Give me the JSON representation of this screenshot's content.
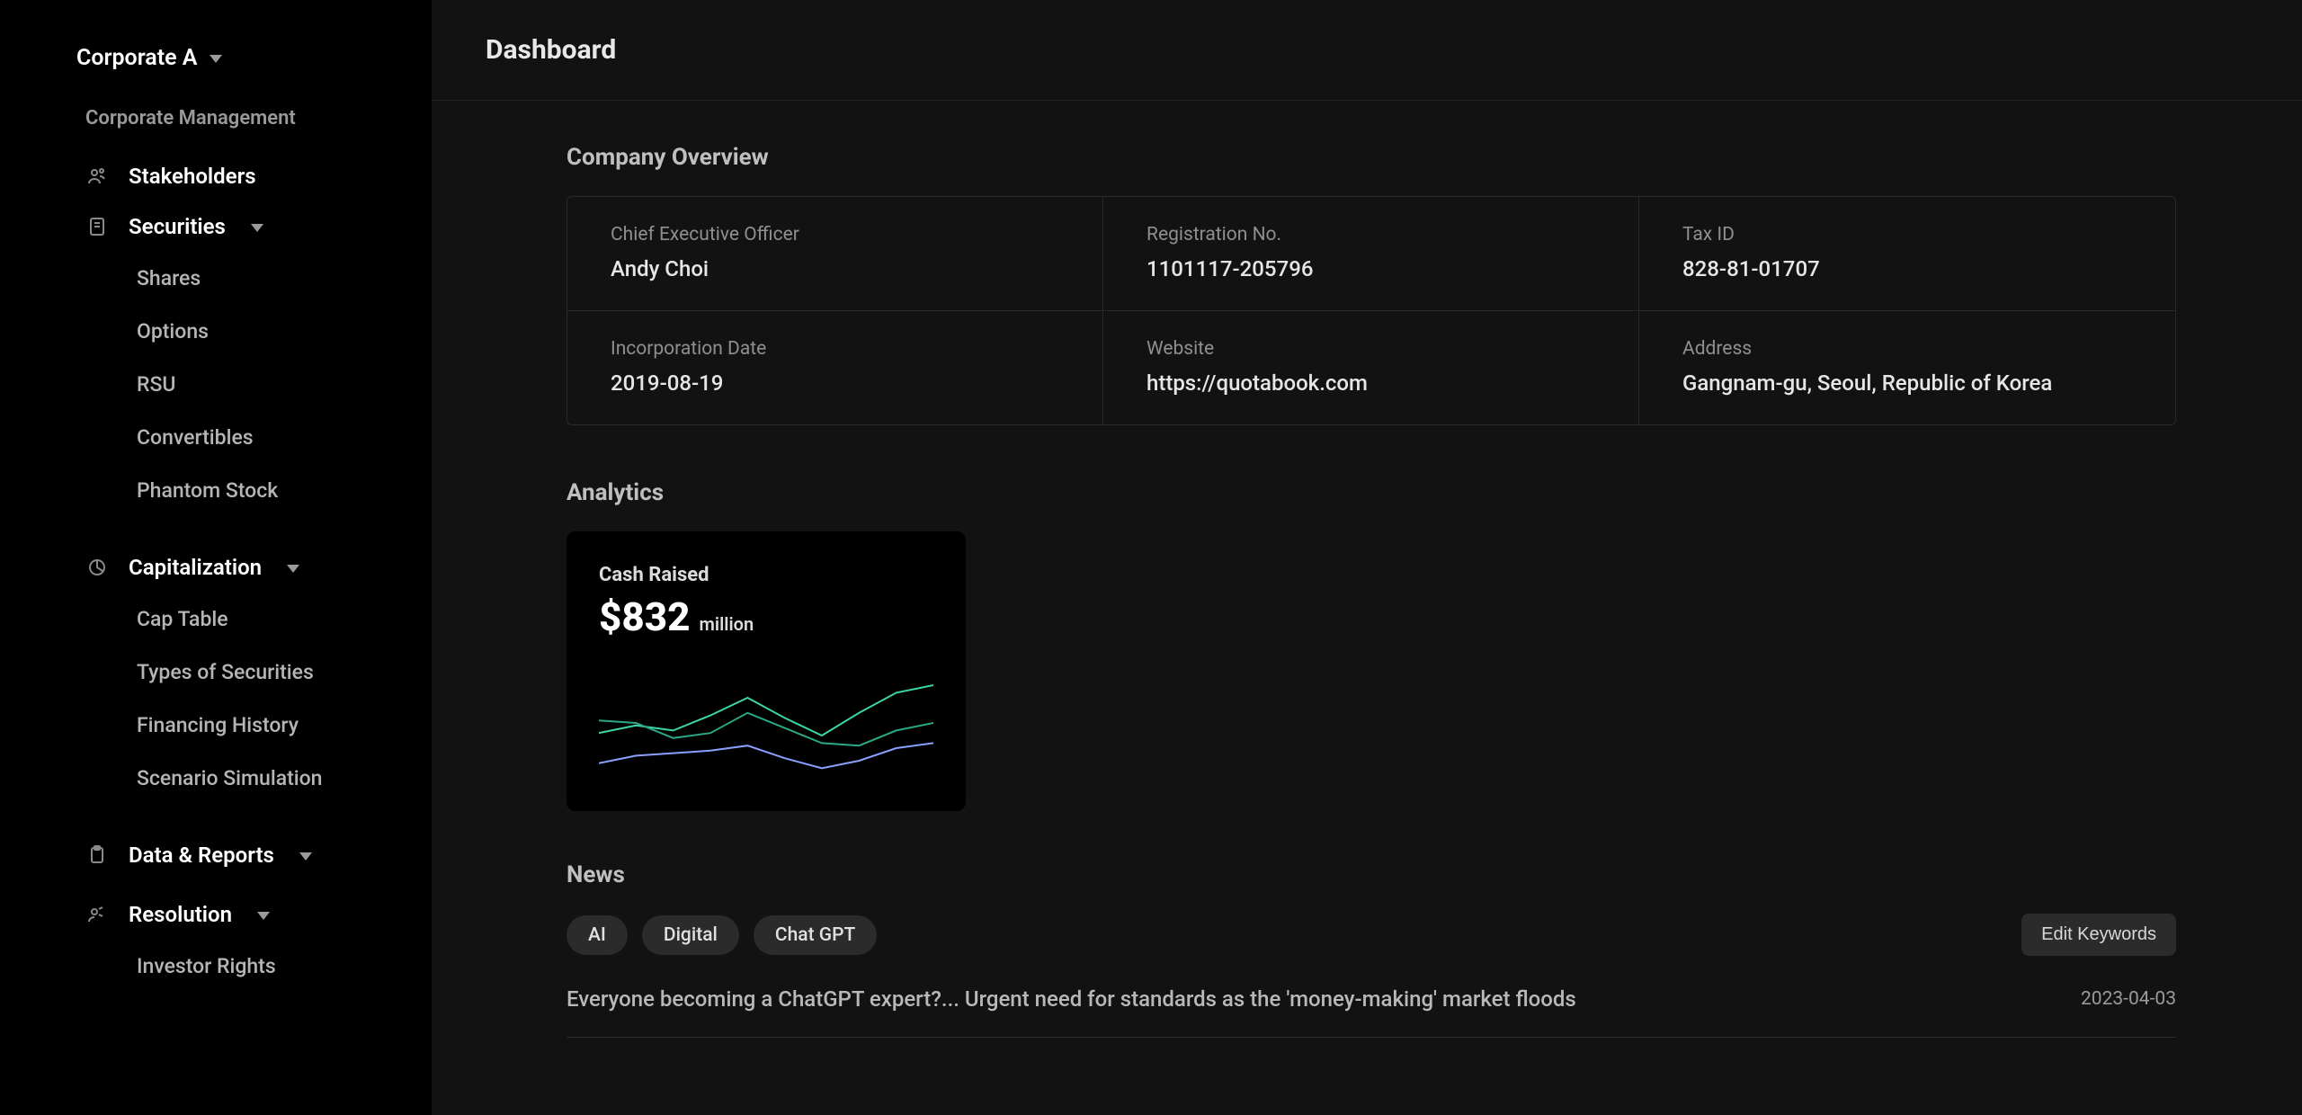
{
  "org": {
    "name": "Corporate A"
  },
  "sidebar": {
    "section_title": "Corporate Management",
    "stakeholders": "Stakeholders",
    "securities": {
      "label": "Securities",
      "shares": "Shares",
      "options": "Options",
      "rsu": "RSU",
      "convertibles": "Convertibles",
      "phantom": "Phantom Stock"
    },
    "capitalization": {
      "label": "Capitalization",
      "cap_table": "Cap Table",
      "types": "Types of Securities",
      "fin_history": "Financing History",
      "scenario": "Scenario Simulation"
    },
    "data_reports": "Data & Reports",
    "resolution": {
      "label": "Resolution",
      "investor_rights": "Investor Rights"
    }
  },
  "page": {
    "title": "Dashboard"
  },
  "overview": {
    "title": "Company Overview",
    "ceo_label": "Chief Executive Officer",
    "ceo_value": "Andy Choi",
    "reg_label": "Registration No.",
    "reg_value": "1101117-205796",
    "tax_label": "Tax ID",
    "tax_value": "828-81-01707",
    "inc_label": "Incorporation Date",
    "inc_value": "2019-08-19",
    "web_label": "Website",
    "web_value": "https://quotabook.com",
    "addr_label": "Address",
    "addr_value": "Gangnam-gu, Seoul, Republic of Korea"
  },
  "analytics": {
    "title": "Analytics",
    "card_title": "Cash Raised",
    "amount": "$832",
    "unit": "million"
  },
  "news": {
    "title": "News",
    "chips": {
      "ai": "AI",
      "digital": "Digital",
      "chatgpt": "Chat GPT"
    },
    "edit_btn": "Edit Keywords",
    "row1_title": "Everyone becoming a ChatGPT expert?... Urgent need for standards as the 'money-making' market floods",
    "row1_date": "2023-04-03"
  },
  "chart_data": {
    "type": "line",
    "x": [
      0,
      1,
      2,
      3,
      4,
      5,
      6,
      7,
      8,
      9
    ],
    "series": [
      {
        "name": "series-a",
        "color": "#3dd6a9",
        "values": [
          42,
          48,
          44,
          56,
          70,
          54,
          40,
          58,
          74,
          80
        ]
      },
      {
        "name": "series-b",
        "color": "#2aa885",
        "values": [
          52,
          50,
          38,
          42,
          58,
          46,
          34,
          32,
          44,
          50
        ]
      },
      {
        "name": "series-c",
        "color": "#8aa0ff",
        "values": [
          18,
          24,
          26,
          28,
          32,
          22,
          14,
          20,
          30,
          34
        ]
      }
    ],
    "ylim": [
      0,
      100
    ]
  }
}
